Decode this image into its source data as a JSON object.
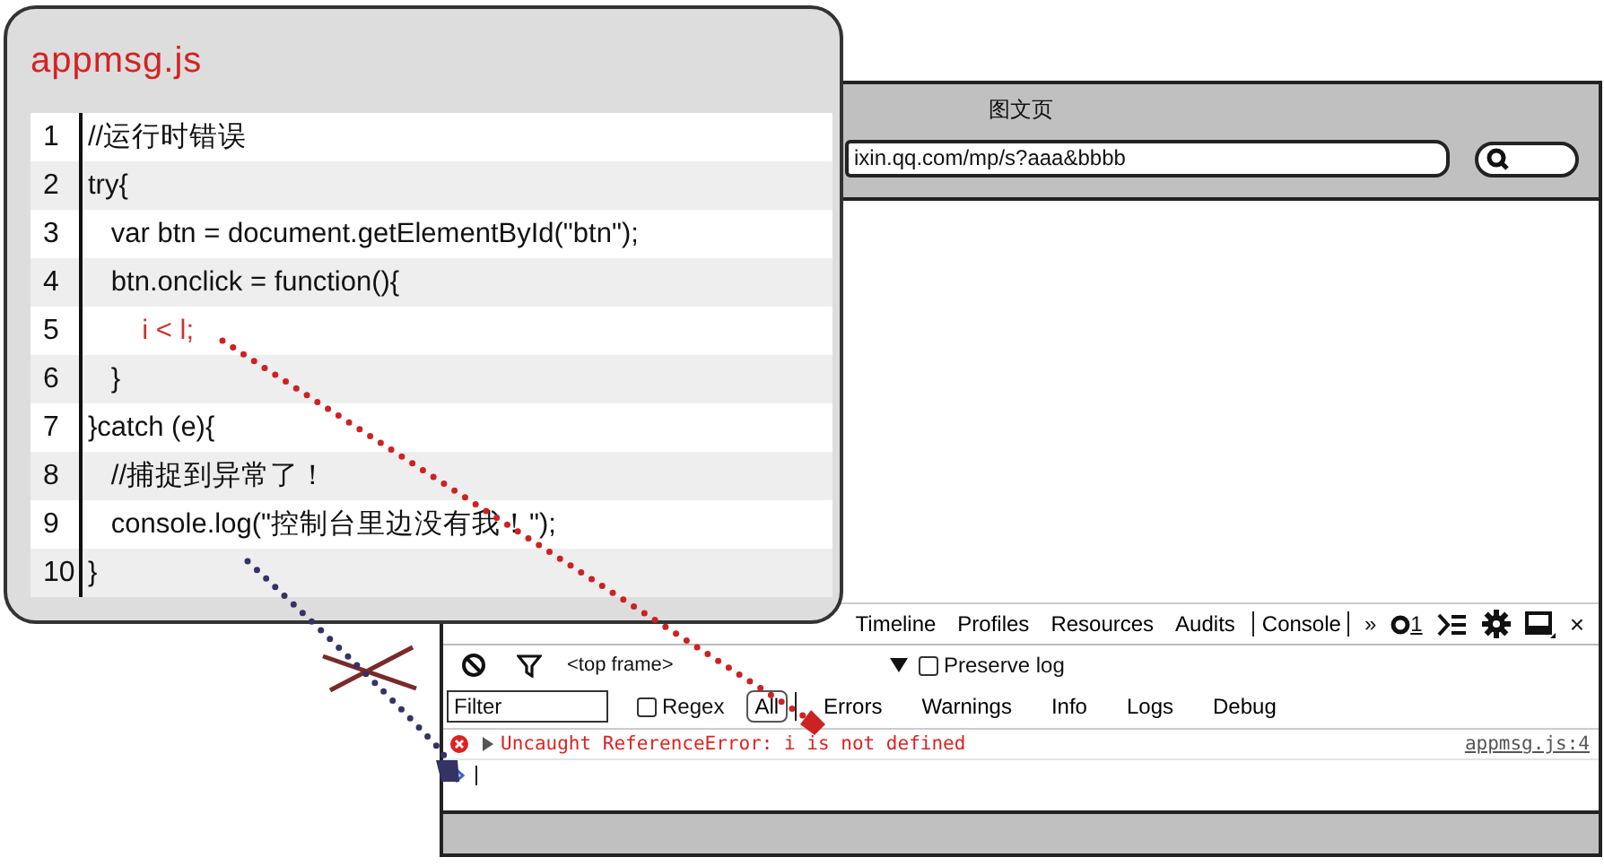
{
  "code_window": {
    "title": "appmsg.js",
    "lines": [
      {
        "number": "1",
        "text": "//运行时错误",
        "kind": "normal"
      },
      {
        "number": "2",
        "text": "try{",
        "kind": "normal"
      },
      {
        "number": "3",
        "text": "   var btn = document.getElementById(\"btn\");",
        "kind": "normal"
      },
      {
        "number": "4",
        "text": "   btn.onclick = function(){",
        "kind": "normal"
      },
      {
        "number": "5",
        "text": "       i < l;",
        "kind": "error"
      },
      {
        "number": "6",
        "text": "   }",
        "kind": "normal"
      },
      {
        "number": "7",
        "text": "}catch (e){",
        "kind": "normal"
      },
      {
        "number": "8",
        "text": "   //捕捉到异常了！",
        "kind": "normal"
      },
      {
        "number": "9",
        "text": "   console.log(\"控制台里边没有我！\");",
        "kind": "normal"
      },
      {
        "number": "10",
        "text": "}",
        "kind": "normal"
      }
    ]
  },
  "browser": {
    "title": "图文页",
    "url": "ixin.qq.com/mp/s?aaa&bbbb"
  },
  "devtools": {
    "tabs": [
      {
        "label": "Timeline",
        "selected": false
      },
      {
        "label": "Profiles",
        "selected": false
      },
      {
        "label": "Resources",
        "selected": false
      },
      {
        "label": "Audits",
        "selected": false
      },
      {
        "label": "Console",
        "selected": true
      }
    ],
    "more": "»",
    "error_count": "1",
    "close": "×",
    "frame": "<top frame>",
    "preserve_log": {
      "label": "Preserve log",
      "checked": false
    },
    "filter": {
      "placeholder": "Filter"
    },
    "regex": {
      "label": "Regex",
      "checked": false
    },
    "levels": [
      {
        "label": "All",
        "selected": true
      },
      {
        "label": "Errors",
        "selected": false
      },
      {
        "label": "Warnings",
        "selected": false
      },
      {
        "label": "Info",
        "selected": false
      },
      {
        "label": "Logs",
        "selected": false
      },
      {
        "label": "Debug",
        "selected": false
      }
    ],
    "messages": [
      {
        "kind": "error",
        "text": "Uncaught ReferenceError: i is not defined",
        "source": "appmsg.js:4"
      }
    ]
  }
}
